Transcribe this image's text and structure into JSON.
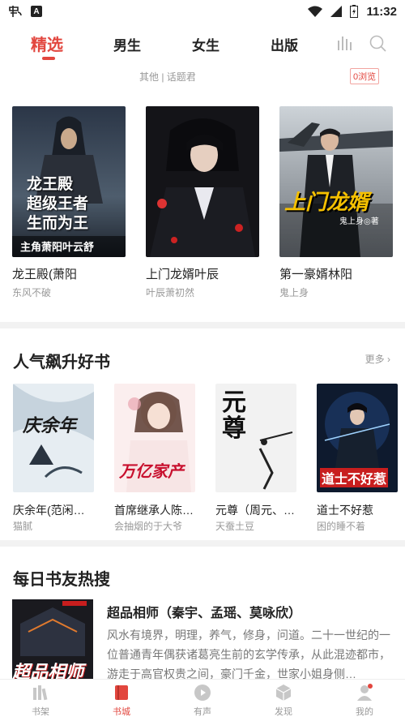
{
  "status": {
    "time": "11:32",
    "notification_badge": "A"
  },
  "top_tabs": {
    "items": [
      "精选",
      "男生",
      "女生",
      "出版"
    ],
    "active": "精选"
  },
  "subline": {
    "links": "其他 | 话题君",
    "browse_badge": "0浏览"
  },
  "featured": [
    {
      "title": "龙王殿(萧阳",
      "author": "东风不破",
      "cover_text": "龙王殿\n超级王者\n生而为王",
      "cover_sub": "主角萧阳叶云舒"
    },
    {
      "title": "上门龙婿叶辰",
      "author": "叶辰萧初然",
      "cover_text": "",
      "cover_sub": ""
    },
    {
      "title": "第一豪婿林阳",
      "author": "鬼上身",
      "cover_text": "上门龙婿",
      "cover_sub": "鬼上身◎著"
    }
  ],
  "popular": {
    "title": "人气飙升好书",
    "more": "更多 ›",
    "books": [
      {
        "title": "庆余年(范闲…",
        "author": "猫腻",
        "cover_text": "庆余年"
      },
      {
        "title": "首席继承人陈…",
        "author": "会抽烟的于大爷",
        "cover_text": "万亿家产"
      },
      {
        "title": "元尊（周元、…",
        "author": "天蚕土豆",
        "cover_text": "元尊"
      },
      {
        "title": "道士不好惹",
        "author": "困的睡不着",
        "cover_text": "道士不好惹"
      }
    ]
  },
  "hot_search": {
    "title": "每日书友热搜",
    "book_title": "超品相师（秦宇、孟瑶、莫咏欣）",
    "description": "风水有境界，明理，养气，修身，问道。二十一世纪的一位普通青年偶获诸葛亮生前的玄学传承，从此混迹都市，游走于高官权贵之间，豪门千金，世家小姐身侧…",
    "cover_text": "超品相师"
  },
  "bottom_nav": {
    "items": [
      "书架",
      "书城",
      "有声",
      "发现",
      "我的"
    ],
    "active": "书城"
  },
  "colors": {
    "accent": "#e2463e",
    "text_primary": "#222222",
    "text_secondary": "#999999",
    "divider": "#f2f2f2"
  }
}
